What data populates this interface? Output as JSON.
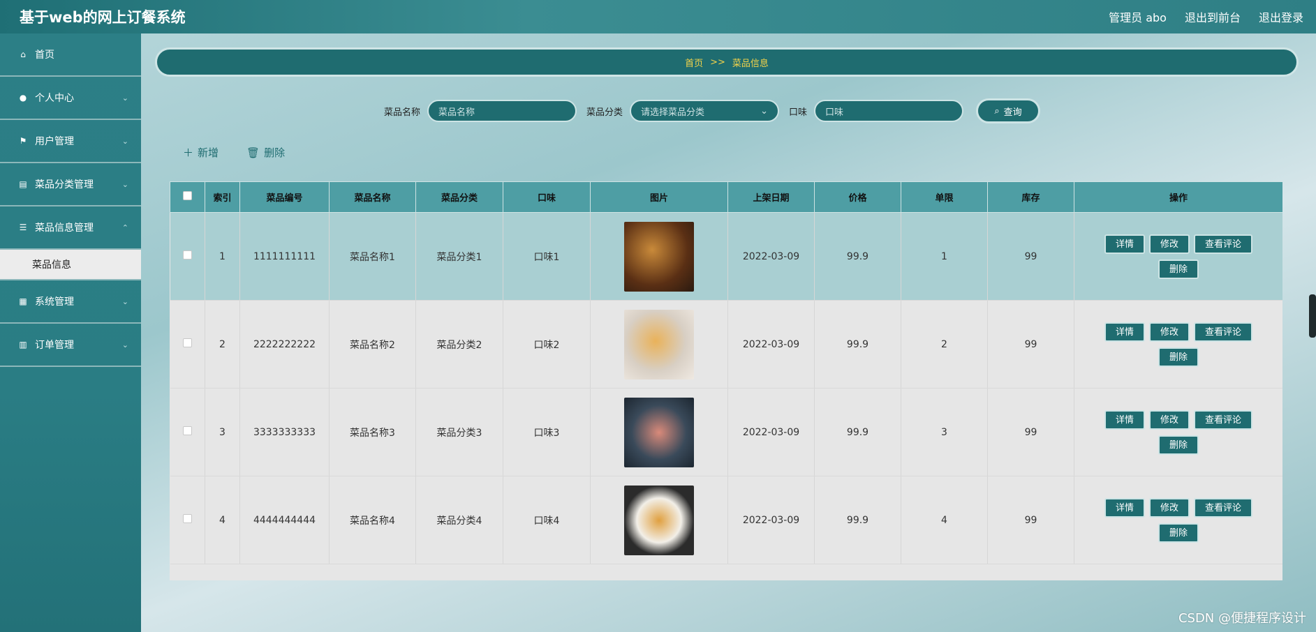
{
  "header": {
    "title": "基于web的网上订餐系统",
    "user": "管理员 abo",
    "back_to_front": "退出到前台",
    "logout": "退出登录"
  },
  "sidebar": {
    "items": [
      {
        "label": "首页",
        "icon": "home-icon"
      },
      {
        "label": "个人中心",
        "icon": "user-icon"
      },
      {
        "label": "用户管理",
        "icon": "flag-icon"
      },
      {
        "label": "菜品分类管理",
        "icon": "category-icon"
      },
      {
        "label": "菜品信息管理",
        "icon": "sliders-icon"
      },
      {
        "label": "系统管理",
        "icon": "grid-icon"
      },
      {
        "label": "订单管理",
        "icon": "chart-icon"
      }
    ],
    "sub_item": "菜品信息"
  },
  "breadcrumb": {
    "home": "首页",
    "sep": ">>",
    "current": "菜品信息"
  },
  "search": {
    "name_label": "菜品名称",
    "name_placeholder": "菜品名称",
    "category_label": "菜品分类",
    "category_placeholder": "请选择菜品分类",
    "taste_label": "口味",
    "taste_placeholder": "口味",
    "query_button": "查询"
  },
  "actions": {
    "add": "新增",
    "delete": "删除"
  },
  "table": {
    "headers": [
      "索引",
      "菜品编号",
      "菜品名称",
      "菜品分类",
      "口味",
      "图片",
      "上架日期",
      "价格",
      "单限",
      "库存",
      "操作"
    ],
    "rows": [
      {
        "index": "1",
        "code": "1111111111",
        "name": "菜品名称1",
        "category": "菜品分类1",
        "taste": "口味1",
        "date": "2022-03-09",
        "price": "99.9",
        "limit": "1",
        "stock": "99"
      },
      {
        "index": "2",
        "code": "2222222222",
        "name": "菜品名称2",
        "category": "菜品分类2",
        "taste": "口味2",
        "date": "2022-03-09",
        "price": "99.9",
        "limit": "2",
        "stock": "99"
      },
      {
        "index": "3",
        "code": "3333333333",
        "name": "菜品名称3",
        "category": "菜品分类3",
        "taste": "口味3",
        "date": "2022-03-09",
        "price": "99.9",
        "limit": "3",
        "stock": "99"
      },
      {
        "index": "4",
        "code": "4444444444",
        "name": "菜品名称4",
        "category": "菜品分类4",
        "taste": "口味4",
        "date": "2022-03-09",
        "price": "99.9",
        "limit": "4",
        "stock": "99"
      }
    ],
    "op_buttons": {
      "detail": "详情",
      "edit": "修改",
      "comments": "查看评论",
      "delete": "删除"
    }
  },
  "watermark": "CSDN @便捷程序设计",
  "colors": {
    "accent": "#1f6c70",
    "header_text": "#f3d34a",
    "highlight_row": "#a9cfd2"
  }
}
